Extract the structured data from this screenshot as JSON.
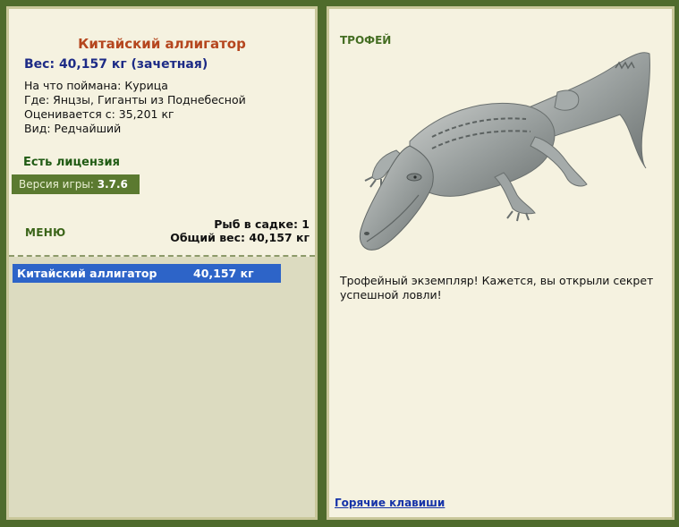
{
  "fish": {
    "name": "Китайский аллигатор",
    "weight_line": "Вес: 40,157 кг (зачетная)",
    "bait": "На что поймана: Курица",
    "location": "Где: Янцзы, Гиганты из Поднебесной",
    "valued": "Оценивается с: 35,201 кг",
    "kind": "Вид: Редчайший"
  },
  "license": "Есть лицензия",
  "version": {
    "label": "Версия игры:",
    "value": "3.7.6"
  },
  "menu_label": "МЕНЮ",
  "stats": {
    "fish_count": "Рыб в садке: 1",
    "total_weight": "Общий вес: 40,157 кг"
  },
  "keepnet": [
    {
      "name": "Китайский аллигатор",
      "weight": "40,157 кг"
    }
  ],
  "trophy": {
    "label": "ТРОФЕЙ",
    "text": "Трофейный экземпляр! Кажется, вы открыли секрет успешной ловли!",
    "image": "alligator-image"
  },
  "hotkeys_label": "Горячие клавиши",
  "colors": {
    "background": "#4f6b2c",
    "panel": "#f5f2e0",
    "title": "#b5461e",
    "weight": "#1d2b86",
    "selection": "#2d64c8"
  }
}
